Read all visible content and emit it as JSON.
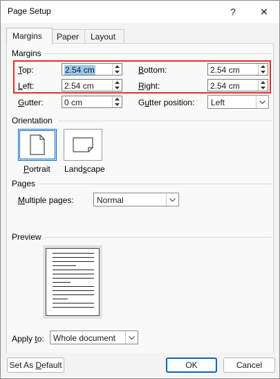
{
  "window": {
    "title": "Page Setup",
    "help_glyph": "?",
    "close_glyph": "✕"
  },
  "tabs": [
    {
      "label": "Margins",
      "active": true
    },
    {
      "label": "Paper",
      "active": false
    },
    {
      "label": "Layout",
      "active": false
    }
  ],
  "margins": {
    "section_label": "Margins",
    "top": {
      "label_mnemonic": "T",
      "label_rest": "op:",
      "value": "2.54 cm"
    },
    "bottom": {
      "label_mnemonic": "B",
      "label_rest": "ottom:",
      "value": "2.54 cm"
    },
    "left": {
      "label_mnemonic": "L",
      "label_rest": "eft:",
      "value": "2.54 cm"
    },
    "right": {
      "label_mnemonic": "R",
      "label_rest": "ight:",
      "value": "2.54 cm"
    },
    "gutter": {
      "label_pre": "",
      "label_mnemonic": "G",
      "label_rest": "utter:",
      "value": "0 cm"
    },
    "gutter_position": {
      "label_pre": "G",
      "label_mnemonic": "u",
      "label_rest": "tter position:",
      "value": "Left"
    }
  },
  "orientation": {
    "section_label": "Orientation",
    "portrait": {
      "label_mnemonic": "P",
      "label_rest": "ortrait",
      "selected": true
    },
    "landscape": {
      "label_pre": "Land",
      "label_mnemonic": "s",
      "label_rest": "cape",
      "selected": false
    }
  },
  "pages": {
    "section_label": "Pages",
    "multiple_pages": {
      "label_mnemonic": "M",
      "label_rest": "ultiple pages:",
      "value": "Normal"
    }
  },
  "preview": {
    "section_label": "Preview"
  },
  "apply_to": {
    "label_pre": "Apply ",
    "label_mnemonic": "t",
    "label_rest": "o:",
    "value": "Whole document"
  },
  "buttons": {
    "set_default_pre": "Set As ",
    "set_default_mnemonic": "D",
    "set_default_rest": "efault",
    "ok": "OK",
    "cancel": "Cancel"
  },
  "colors": {
    "highlight": "#e0302a",
    "accent": "#0067c0",
    "selection": "#99c9ef"
  }
}
